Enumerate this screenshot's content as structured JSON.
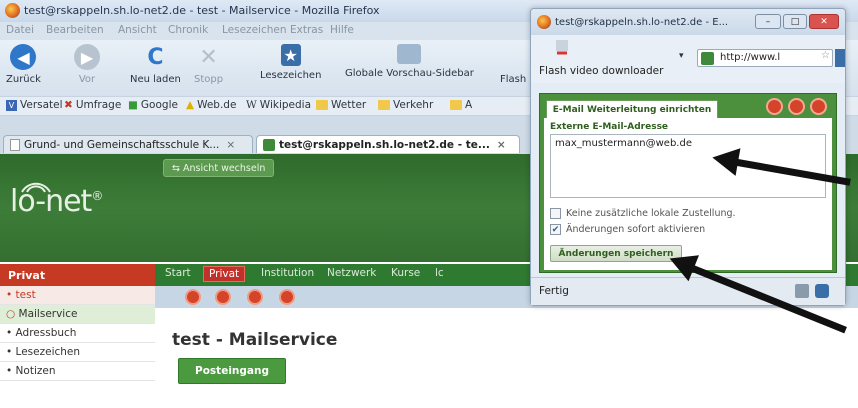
{
  "browser": {
    "title": "test@rskappeln.sh.lo-net2.de - test - Mailservice - Mozilla Firefox",
    "menu": [
      "Datei",
      "Bearbeiten",
      "Ansicht",
      "Chronik",
      "Lesezeichen",
      "Extras",
      "Hilfe"
    ],
    "nav": {
      "back": "Zurück",
      "forward": "Vor",
      "reload": "Neu laden",
      "stop": "Stopp",
      "bookmarks": "Lesezeichen",
      "sidebar": "Globale Vorschau-Sidebar",
      "flash": "Flash"
    },
    "bookmarks": [
      "Versatel",
      "Umfrage",
      "Google",
      "Web.de",
      "Wikipedia",
      "Wetter",
      "Verkehr",
      "A"
    ],
    "tabs": [
      {
        "label": "Grund- und Gemeinschaftsschule K...",
        "close": "×"
      },
      {
        "label": "test@rskappeln.sh.lo-net2.de - te...",
        "close": "×"
      }
    ]
  },
  "site": {
    "logo": "lo-net",
    "logo_mark": "®",
    "switch_view": "Ansicht wechseln",
    "topnav": [
      "Start",
      "Privat",
      "Institution",
      "Netzwerk",
      "Kurse",
      "lc"
    ],
    "sidebar_title": "Privat",
    "sidebar_items": [
      "test",
      "Mailservice",
      "Adressbuch",
      "Lesezeichen",
      "Notizen"
    ],
    "page_title": "test - Mailservice",
    "inbox_button": "Posteingang"
  },
  "popup": {
    "title": "test@rskappeln.sh.lo-net2.de - E...",
    "toolbar_label": "Flash video downloader",
    "url": "http://www.l",
    "tab_label": "E-Mail Weiterleitung einrichten",
    "field_label": "Externe E-Mail-Adresse",
    "email_value": "max_mustermann@web.de",
    "checkbox1": {
      "label": "Keine zusätzliche lokale Zustellung.",
      "checked": false
    },
    "checkbox2": {
      "label": "Änderungen sofort aktivieren",
      "checked": true
    },
    "save_button": "Änderungen speichern",
    "status": "Fertig"
  }
}
